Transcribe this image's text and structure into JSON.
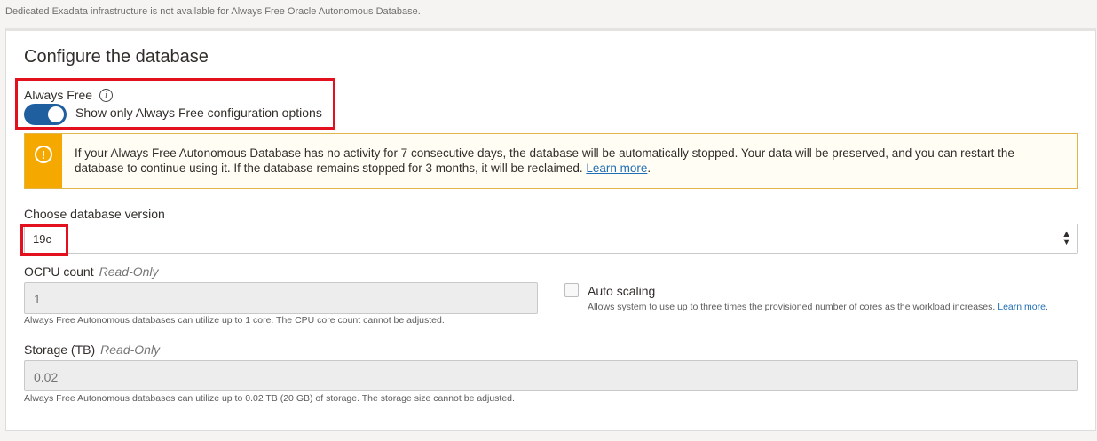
{
  "top_note": "Dedicated Exadata infrastructure is not available for Always Free Oracle Autonomous Database.",
  "section": {
    "title": "Configure the database",
    "always_free": {
      "label": "Always Free",
      "info_icon": "i",
      "toggle_on": true,
      "toggle_text": "Show only Always Free configuration options"
    },
    "notice": {
      "icon": "!",
      "text": "If your Always Free Autonomous Database has no activity for 7 consecutive days, the database will be automatically stopped. Your data will be preserved, and you can restart the database to continue using it. If the database remains stopped for 3 months, it will be reclaimed.",
      "link": "Learn more",
      "end": "."
    },
    "db_version": {
      "label": "Choose database version",
      "value": "19c"
    },
    "ocpu": {
      "label": "OCPU count",
      "readonly": "Read-Only",
      "value": "1",
      "help": "Always Free Autonomous databases can utilize up to 1 core. The CPU core count cannot be adjusted."
    },
    "auto_scaling": {
      "label": "Auto scaling",
      "checked": false,
      "help": "Allows system to use up to three times the provisioned number of cores as the workload increases.",
      "link": "Learn more",
      "end": "."
    },
    "storage": {
      "label": "Storage (TB)",
      "readonly": "Read-Only",
      "value": "0.02",
      "help": "Always Free Autonomous databases can utilize up to 0.02 TB (20 GB) of storage. The storage size cannot be adjusted."
    }
  },
  "colors": {
    "highlight": "#e3101e",
    "toggle": "#1f5fa0",
    "warning": "#f5a800",
    "link": "#1f6fb5"
  }
}
